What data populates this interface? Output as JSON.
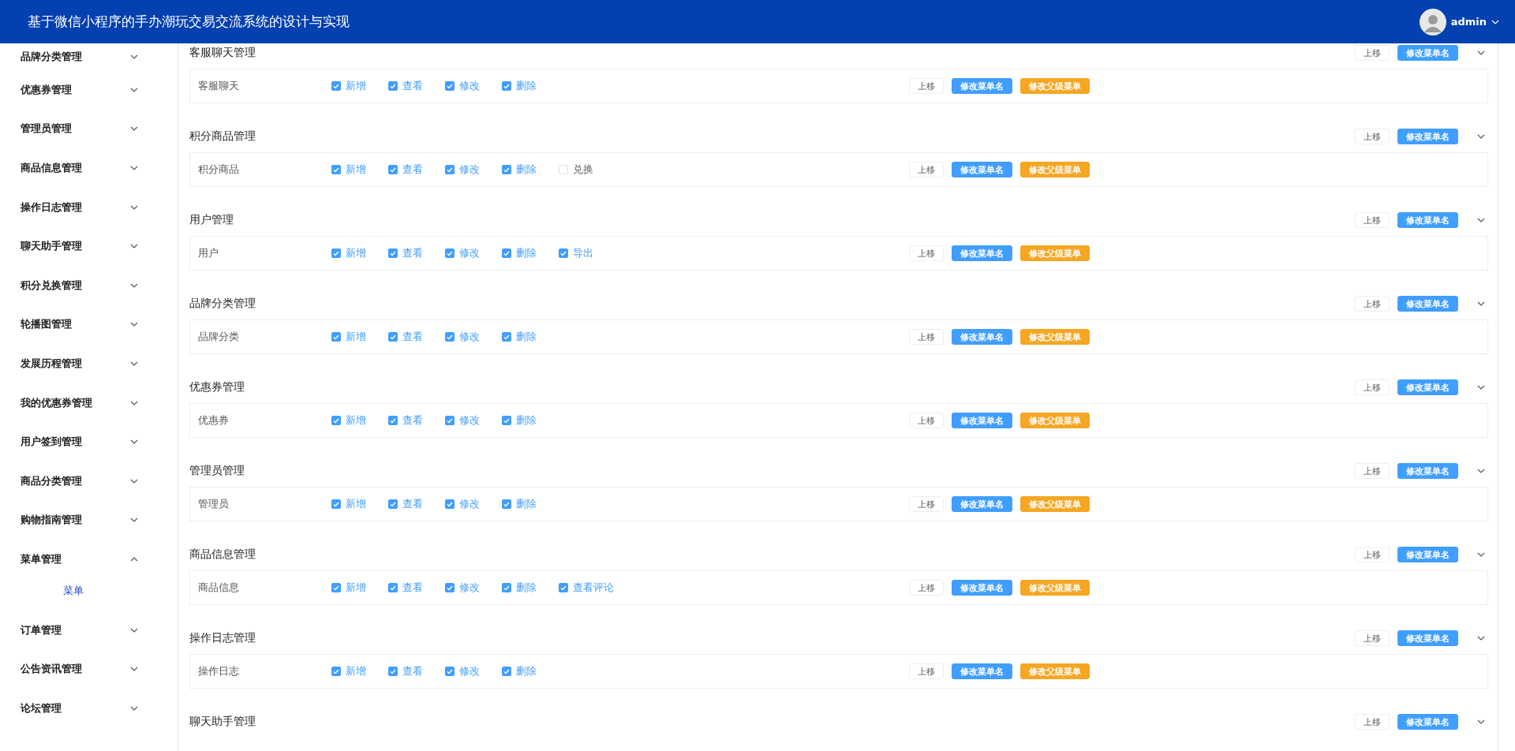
{
  "header": {
    "title": "基于微信小程序的手办潮玩交易交流系统的设计与实现",
    "user": "admin"
  },
  "sidebar": {
    "items": [
      {
        "label": "品牌分类管理",
        "expanded": false
      },
      {
        "label": "优惠券管理",
        "expanded": false
      },
      {
        "label": "管理员管理",
        "expanded": false
      },
      {
        "label": "商品信息管理",
        "expanded": false
      },
      {
        "label": "操作日志管理",
        "expanded": false
      },
      {
        "label": "聊天助手管理",
        "expanded": false
      },
      {
        "label": "积分兑换管理",
        "expanded": false
      },
      {
        "label": "轮播图管理",
        "expanded": false
      },
      {
        "label": "发展历程管理",
        "expanded": false
      },
      {
        "label": "我的优惠券管理",
        "expanded": false
      },
      {
        "label": "用户签到管理",
        "expanded": false
      },
      {
        "label": "商品分类管理",
        "expanded": false
      },
      {
        "label": "购物指南管理",
        "expanded": false
      },
      {
        "label": "菜单管理",
        "expanded": true,
        "children": [
          {
            "label": "菜单",
            "selected": true
          }
        ]
      },
      {
        "label": "订单管理",
        "expanded": false
      },
      {
        "label": "公告资讯管理",
        "expanded": false
      },
      {
        "label": "论坛管理",
        "expanded": false
      }
    ]
  },
  "sections": [
    {
      "title": "客服聊天管理",
      "move_up": "上移",
      "rename": "修改菜单名",
      "children": [
        {
          "name": "客服聊天",
          "permissions": [
            {
              "label": "新增",
              "checked": true
            },
            {
              "label": "查看",
              "checked": true
            },
            {
              "label": "修改",
              "checked": true
            },
            {
              "label": "删除",
              "checked": true
            }
          ],
          "move_up": "上移",
          "rename": "修改菜单名",
          "change_parent": "修改父级菜单"
        }
      ]
    },
    {
      "title": "积分商品管理",
      "move_up": "上移",
      "rename": "修改菜单名",
      "children": [
        {
          "name": "积分商品",
          "permissions": [
            {
              "label": "新增",
              "checked": true
            },
            {
              "label": "查看",
              "checked": true
            },
            {
              "label": "修改",
              "checked": true
            },
            {
              "label": "删除",
              "checked": true
            },
            {
              "label": "兑换",
              "checked": false
            }
          ],
          "move_up": "上移",
          "rename": "修改菜单名",
          "change_parent": "修改父级菜单"
        }
      ]
    },
    {
      "title": "用户管理",
      "move_up": "上移",
      "rename": "修改菜单名",
      "children": [
        {
          "name": "用户",
          "permissions": [
            {
              "label": "新增",
              "checked": true
            },
            {
              "label": "查看",
              "checked": true
            },
            {
              "label": "修改",
              "checked": true
            },
            {
              "label": "删除",
              "checked": true
            },
            {
              "label": "导出",
              "checked": true
            }
          ],
          "move_up": "上移",
          "rename": "修改菜单名",
          "change_parent": "修改父级菜单"
        }
      ]
    },
    {
      "title": "品牌分类管理",
      "move_up": "上移",
      "rename": "修改菜单名",
      "children": [
        {
          "name": "品牌分类",
          "permissions": [
            {
              "label": "新增",
              "checked": true
            },
            {
              "label": "查看",
              "checked": true
            },
            {
              "label": "修改",
              "checked": true
            },
            {
              "label": "删除",
              "checked": true
            }
          ],
          "move_up": "上移",
          "rename": "修改菜单名",
          "change_parent": "修改父级菜单"
        }
      ]
    },
    {
      "title": "优惠券管理",
      "move_up": "上移",
      "rename": "修改菜单名",
      "children": [
        {
          "name": "优惠券",
          "permissions": [
            {
              "label": "新增",
              "checked": true
            },
            {
              "label": "查看",
              "checked": true
            },
            {
              "label": "修改",
              "checked": true
            },
            {
              "label": "删除",
              "checked": true
            }
          ],
          "move_up": "上移",
          "rename": "修改菜单名",
          "change_parent": "修改父级菜单"
        }
      ]
    },
    {
      "title": "管理员管理",
      "move_up": "上移",
      "rename": "修改菜单名",
      "children": [
        {
          "name": "管理员",
          "permissions": [
            {
              "label": "新增",
              "checked": true
            },
            {
              "label": "查看",
              "checked": true
            },
            {
              "label": "修改",
              "checked": true
            },
            {
              "label": "删除",
              "checked": true
            }
          ],
          "move_up": "上移",
          "rename": "修改菜单名",
          "change_parent": "修改父级菜单"
        }
      ]
    },
    {
      "title": "商品信息管理",
      "move_up": "上移",
      "rename": "修改菜单名",
      "children": [
        {
          "name": "商品信息",
          "permissions": [
            {
              "label": "新增",
              "checked": true
            },
            {
              "label": "查看",
              "checked": true
            },
            {
              "label": "修改",
              "checked": true
            },
            {
              "label": "删除",
              "checked": true
            },
            {
              "label": "查看评论",
              "checked": true
            }
          ],
          "move_up": "上移",
          "rename": "修改菜单名",
          "change_parent": "修改父级菜单"
        }
      ]
    },
    {
      "title": "操作日志管理",
      "move_up": "上移",
      "rename": "修改菜单名",
      "children": [
        {
          "name": "操作日志",
          "permissions": [
            {
              "label": "新增",
              "checked": true
            },
            {
              "label": "查看",
              "checked": true
            },
            {
              "label": "修改",
              "checked": true
            },
            {
              "label": "删除",
              "checked": true
            }
          ],
          "move_up": "上移",
          "rename": "修改菜单名",
          "change_parent": "修改父级菜单"
        }
      ]
    },
    {
      "title": "聊天助手管理",
      "move_up": "上移",
      "rename": "修改菜单名"
    }
  ]
}
